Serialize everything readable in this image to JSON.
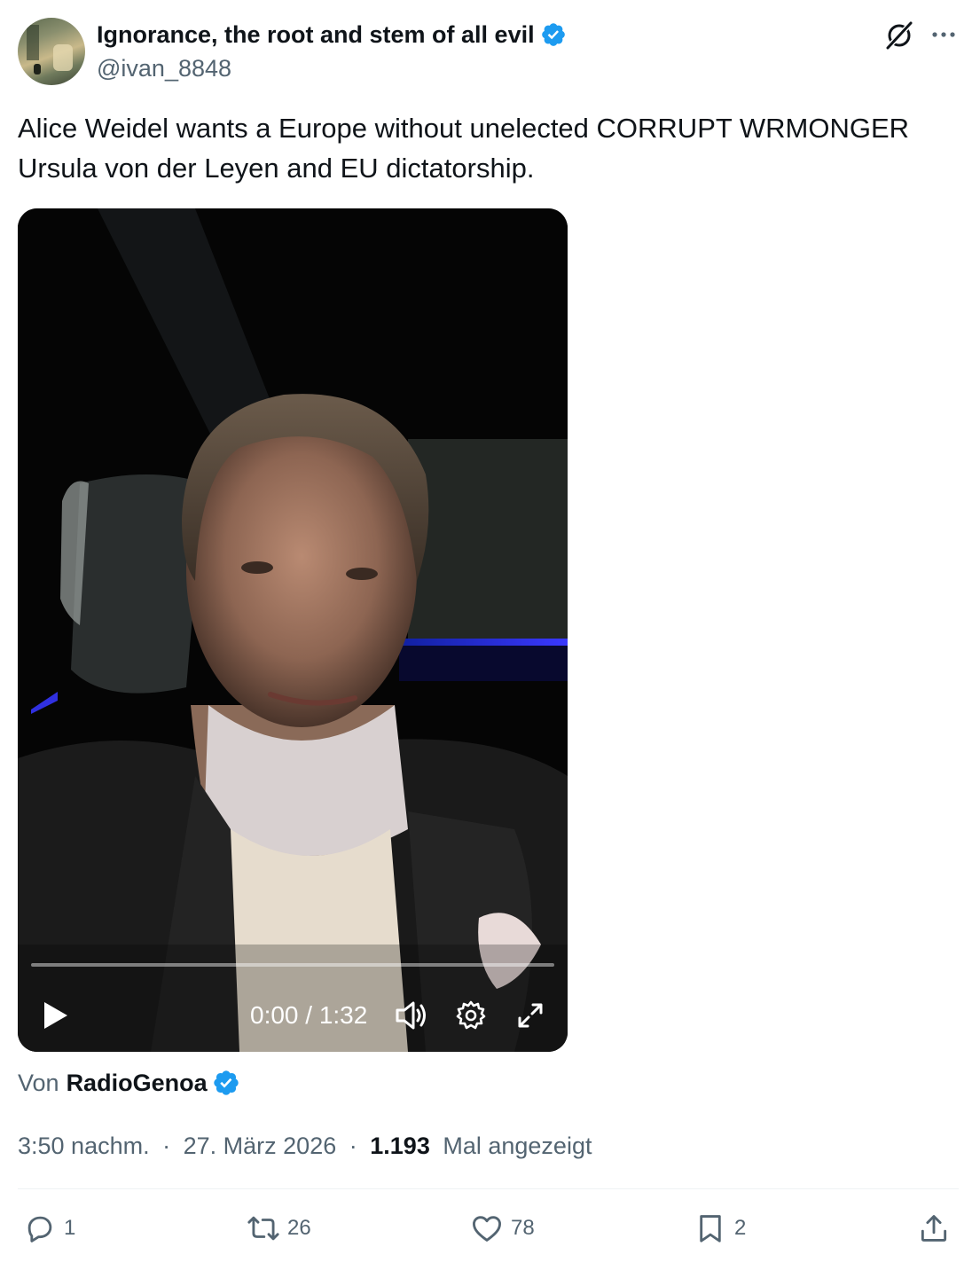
{
  "author": {
    "display_name": "Ignorance, the root and stem of all evil",
    "handle": "@ivan_8848",
    "verified_icon": "verified-badge-icon"
  },
  "header_icons": [
    "grok-icon",
    "more-options-icon"
  ],
  "tweet": {
    "text": "Alice Weidel wants a Europe without unelected CORRUPT WRMONGER Ursula von der Leyen and EU dictatorship."
  },
  "video": {
    "time_label": "0:00 / 1:32",
    "progress_fraction": 0,
    "controls": [
      "play-icon",
      "volume-icon",
      "settings-icon",
      "fullscreen-icon"
    ]
  },
  "source": {
    "prefix": "Von",
    "name": "RadioGenoa"
  },
  "meta": {
    "time": "3:50 nachm.",
    "separator": "·",
    "date": "27. März 2026",
    "views_count": "1.193",
    "views_label": "Mal angezeigt"
  },
  "actions": {
    "replies": "1",
    "reposts": "26",
    "likes": "78",
    "bookmarks": "2"
  },
  "colors": {
    "verified": "#1d9bf0",
    "secondary_text": "#536471",
    "primary_text": "#0f1419"
  }
}
